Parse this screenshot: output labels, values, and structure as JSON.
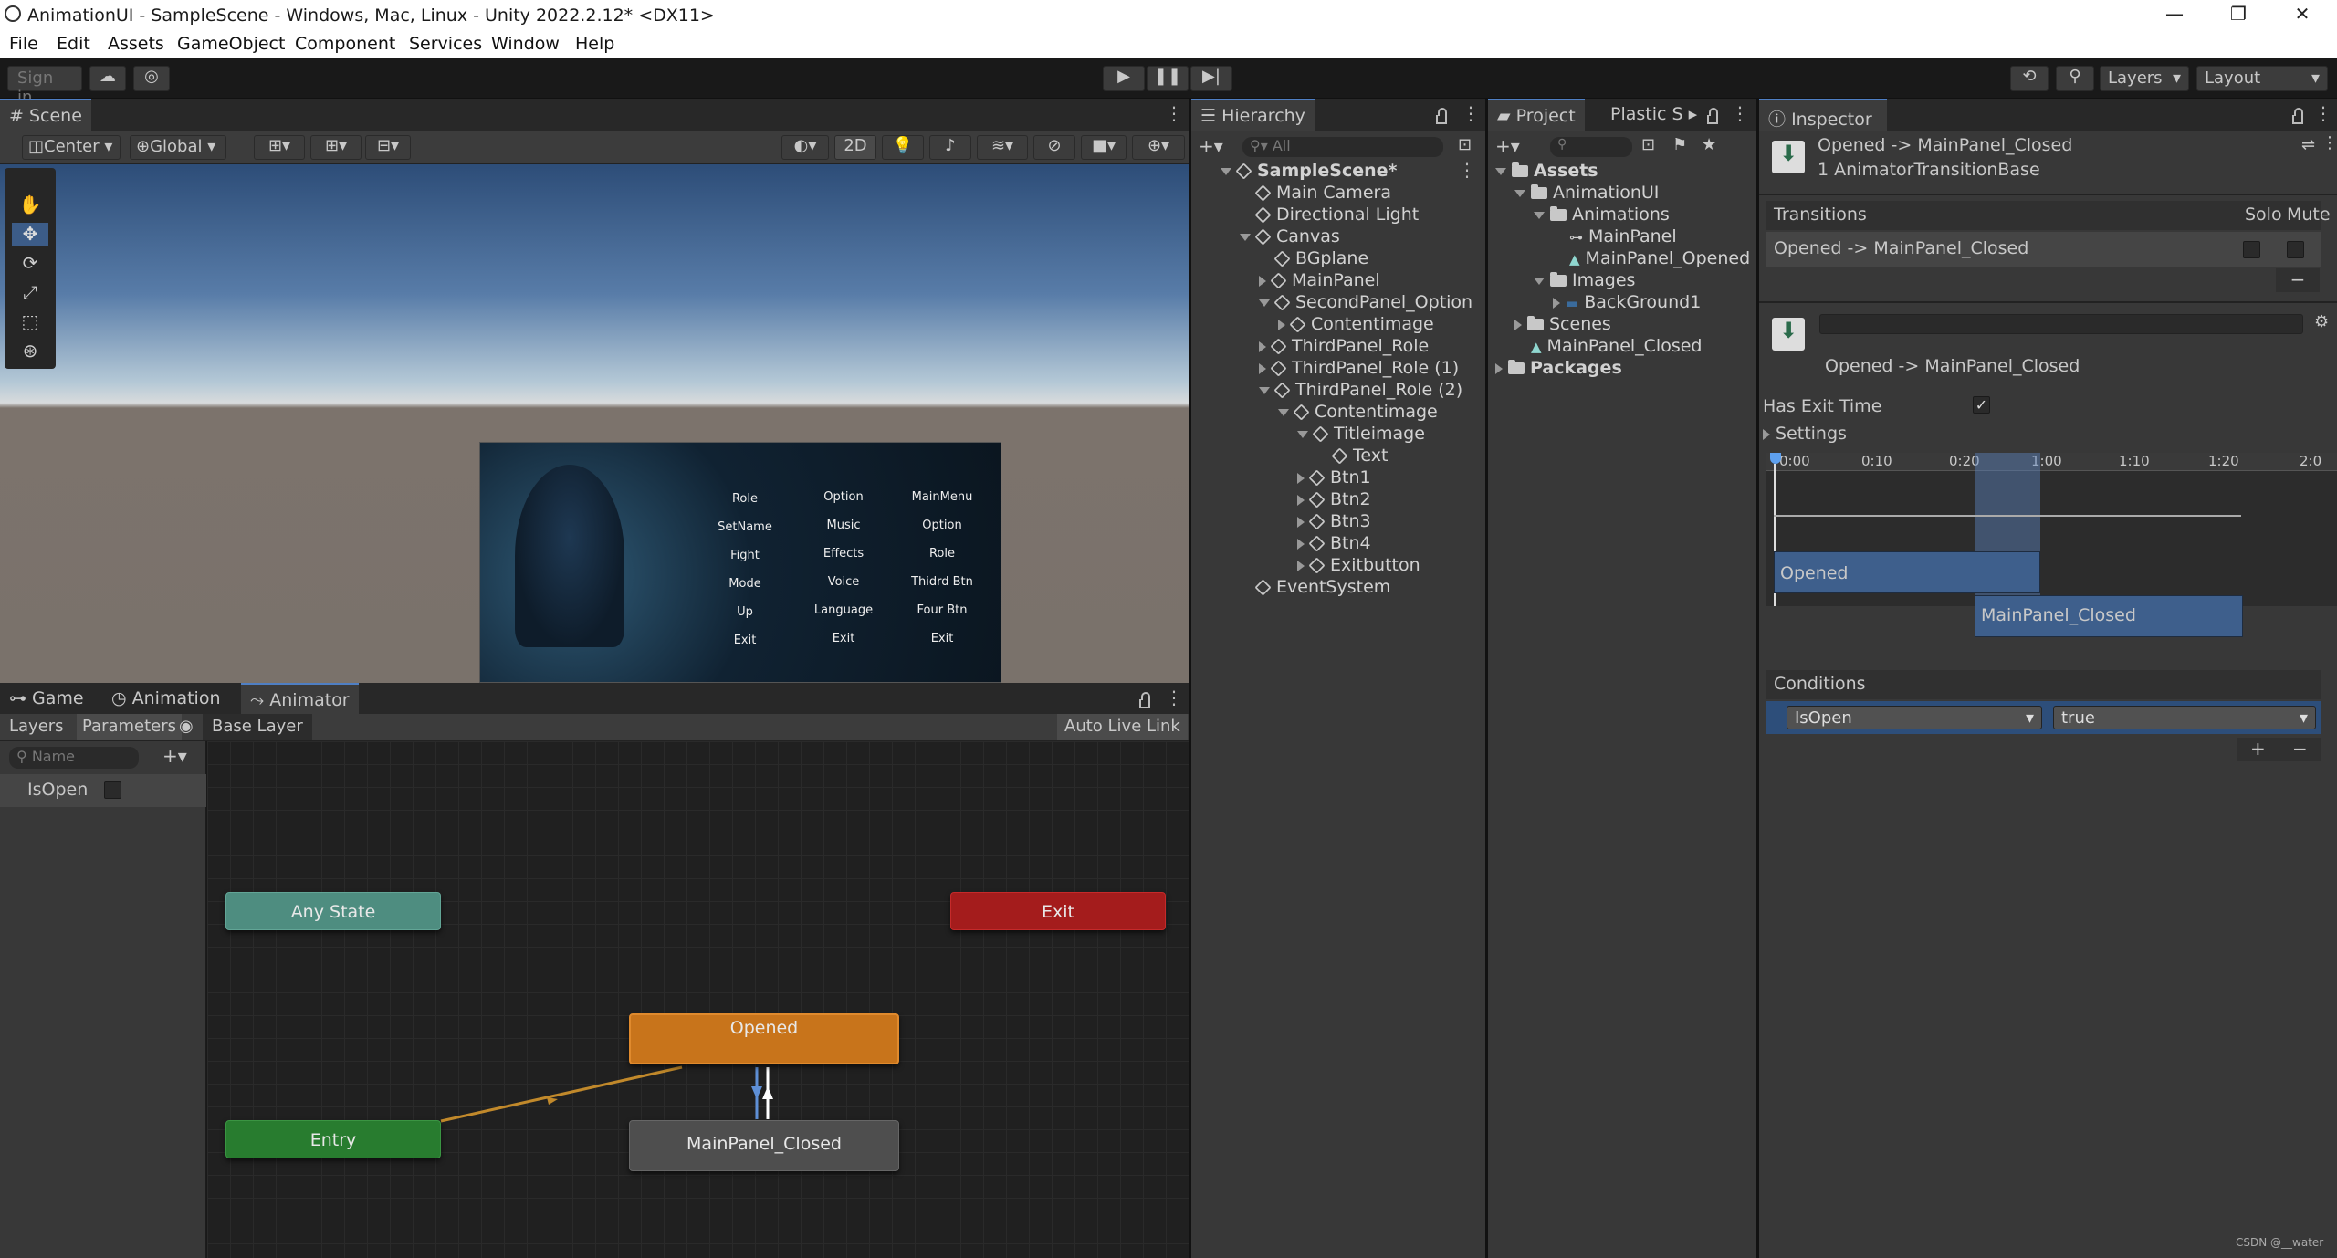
{
  "window": {
    "title": "AnimationUI - SampleScene - Windows, Mac, Linux - Unity 2022.2.12* <DX11>"
  },
  "menu": [
    "File",
    "Edit",
    "Assets",
    "GameObject",
    "Component",
    "Services",
    "Window",
    "Help"
  ],
  "toolbar": {
    "signin": "Sign in",
    "layers": "Layers",
    "layout": "Layout"
  },
  "scene": {
    "tab": "Scene",
    "pivot": "Center",
    "space": "Global",
    "mode2d": "2D",
    "game_ui": {
      "col1": [
        "Role",
        "SetName",
        "Fight",
        "Mode",
        "Up",
        "Exit"
      ],
      "col2": [
        "Option",
        "Music",
        "Effects",
        "Voice",
        "Language",
        "Exit"
      ],
      "col3": [
        "MainMenu",
        "Option",
        "Role",
        "Thidrd Btn",
        "Four Btn",
        "Exit"
      ]
    }
  },
  "bottom_tabs": [
    "Game",
    "Animation",
    "Animator"
  ],
  "animator": {
    "layers_tab": "Layers",
    "params_tab": "Parameters",
    "layer_name": "Base Layer",
    "live_link": "Auto Live Link",
    "search_placeholder": "Name",
    "param": "IsOpen",
    "nodes": {
      "any": "Any State",
      "exit": "Exit",
      "opened": "Opened",
      "entry": "Entry",
      "closed": "MainPanel_Closed"
    }
  },
  "hierarchy": {
    "tab": "Hierarchy",
    "search_placeholder": "All",
    "rows": [
      {
        "label": "SampleScene*",
        "depth": 0,
        "arrow": "down",
        "bold": true
      },
      {
        "label": "Main Camera",
        "depth": 1,
        "arrow": ""
      },
      {
        "label": "Directional Light",
        "depth": 1,
        "arrow": ""
      },
      {
        "label": "Canvas",
        "depth": 1,
        "arrow": "down"
      },
      {
        "label": "BGplane",
        "depth": 2,
        "arrow": ""
      },
      {
        "label": "MainPanel",
        "depth": 2,
        "arrow": "right"
      },
      {
        "label": "SecondPanel_Option",
        "depth": 2,
        "arrow": "down"
      },
      {
        "label": "Contentimage",
        "depth": 3,
        "arrow": "right"
      },
      {
        "label": "ThirdPanel_Role",
        "depth": 2,
        "arrow": "right"
      },
      {
        "label": "ThirdPanel_Role (1)",
        "depth": 2,
        "arrow": "right"
      },
      {
        "label": "ThirdPanel_Role (2)",
        "depth": 2,
        "arrow": "down"
      },
      {
        "label": "Contentimage",
        "depth": 3,
        "arrow": "down"
      },
      {
        "label": "Titleimage",
        "depth": 4,
        "arrow": "down"
      },
      {
        "label": "Text",
        "depth": 5,
        "arrow": ""
      },
      {
        "label": "Btn1",
        "depth": 4,
        "arrow": "right"
      },
      {
        "label": "Btn2",
        "depth": 4,
        "arrow": "right"
      },
      {
        "label": "Btn3",
        "depth": 4,
        "arrow": "right"
      },
      {
        "label": "Btn4",
        "depth": 4,
        "arrow": "right"
      },
      {
        "label": "Exitbutton",
        "depth": 4,
        "arrow": "right"
      },
      {
        "label": "EventSystem",
        "depth": 1,
        "arrow": ""
      }
    ]
  },
  "project": {
    "tab": "Project",
    "tab2": "Plastic S",
    "rows": [
      {
        "label": "Assets",
        "depth": 0,
        "arrow": "down",
        "icon": "folder",
        "bold": true
      },
      {
        "label": "AnimationUI",
        "depth": 1,
        "arrow": "down",
        "icon": "folder"
      },
      {
        "label": "Animations",
        "depth": 2,
        "arrow": "down",
        "icon": "folder"
      },
      {
        "label": "MainPanel",
        "depth": 3,
        "arrow": "",
        "icon": "controller"
      },
      {
        "label": "MainPanel_Opened",
        "depth": 3,
        "arrow": "",
        "icon": "anim"
      },
      {
        "label": "Images",
        "depth": 2,
        "arrow": "down",
        "icon": "folder"
      },
      {
        "label": "BackGround1",
        "depth": 3,
        "arrow": "right",
        "icon": "image"
      },
      {
        "label": "Scenes",
        "depth": 1,
        "arrow": "right",
        "icon": "folder"
      },
      {
        "label": "MainPanel_Closed",
        "depth": 1,
        "arrow": "",
        "icon": "anim"
      },
      {
        "label": "Packages",
        "depth": 0,
        "arrow": "right",
        "icon": "folder",
        "bold": true
      }
    ]
  },
  "inspector": {
    "tab": "Inspector",
    "header_title": "Opened -> MainPanel_Closed",
    "header_sub": "1 AnimatorTransitionBase",
    "transitions_label": "Transitions",
    "solo": "Solo",
    "mute": "Mute",
    "transition_item": "Opened -> MainPanel_Closed",
    "transition_name": "Opened -> MainPanel_Closed",
    "has_exit_time": "Has Exit Time",
    "settings": "Settings",
    "timeline_ticks": [
      "0:00",
      "0:10",
      "0:20",
      "1:00",
      "1:10",
      "1:20",
      "2:0"
    ],
    "clip_a": "Opened",
    "clip_b": "MainPanel_Closed",
    "conditions": "Conditions",
    "cond_param": "IsOpen",
    "cond_value": "true"
  },
  "watermark": "CSDN @__water"
}
